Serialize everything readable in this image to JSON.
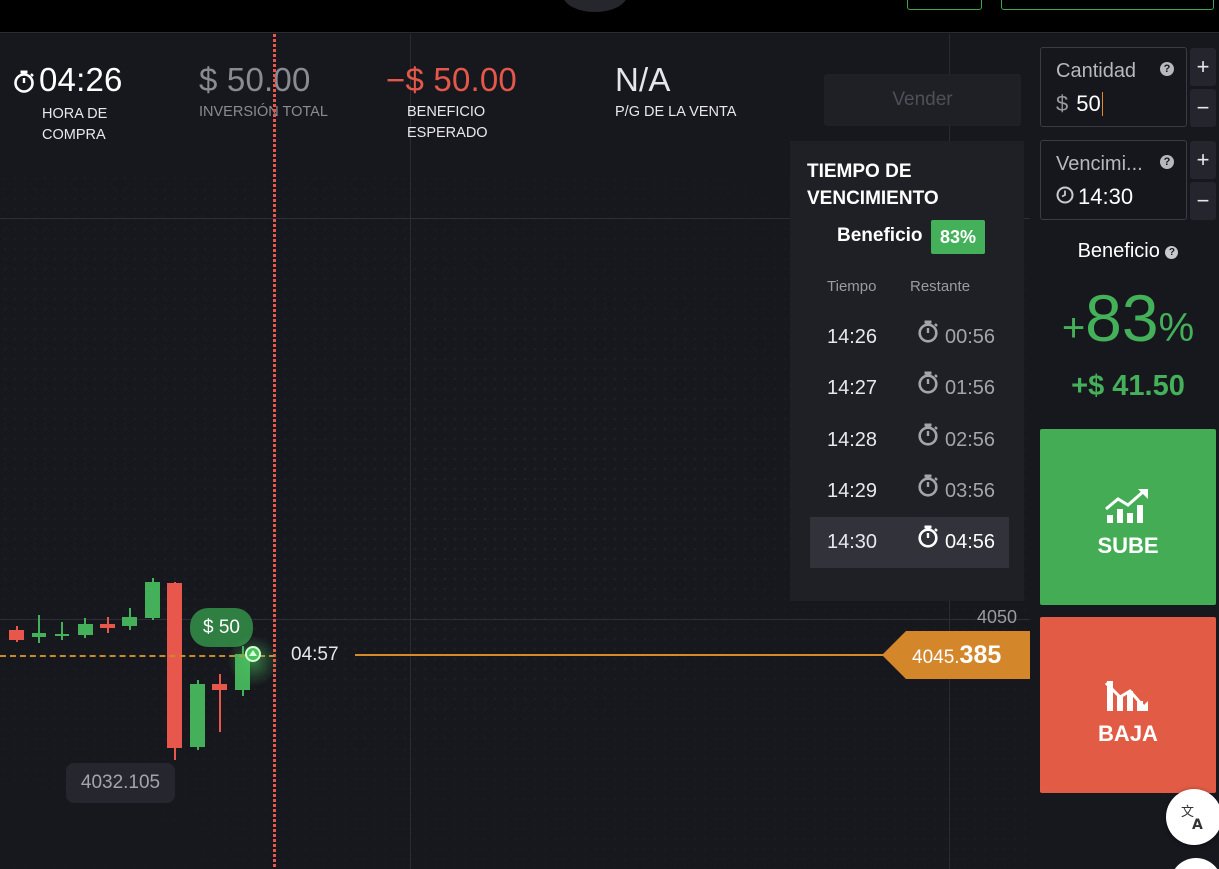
{
  "header": {
    "time_value": "04:26",
    "time_label": "HORA DE COMPRA",
    "investment_value": "$ 50.00",
    "investment_label": "INVERSIÓN TOTAL",
    "expected_value": "−$ 50.00",
    "expected_label": "BENEFICIO ESPERADO",
    "pl_value": "N/A",
    "pl_label": "P/G DE LA VENTA"
  },
  "sell_label": "Vender",
  "chart": {
    "trade_pill": "$ 50",
    "cursor_time": "04:57",
    "price_tick": "4050",
    "current_price_prefix": "4045.",
    "current_price_bold": "385",
    "low_price": "4032.105"
  },
  "expiration_popup": {
    "title": "TIEMPO DE VENCIMIENTO",
    "profit_label": "Beneficio",
    "profit_badge": "83%",
    "col_time": "Tiempo",
    "col_remaining": "Restante",
    "rows": [
      {
        "time": "14:26",
        "remaining": "00:56"
      },
      {
        "time": "14:27",
        "remaining": "01:56"
      },
      {
        "time": "14:28",
        "remaining": "02:56"
      },
      {
        "time": "14:29",
        "remaining": "03:56"
      },
      {
        "time": "14:30",
        "remaining": "04:56"
      }
    ],
    "selected_row": 4
  },
  "panel": {
    "amount_label": "Cantidad",
    "amount_currency": "$",
    "amount_value": "50",
    "expiry_label": "Vencimi...",
    "expiry_value": "14:30",
    "plus": "+",
    "minus": "−",
    "help": "?",
    "profit_label": "Beneficio",
    "profit_pct_prefix": "+",
    "profit_pct": "83",
    "profit_pct_suffix": "%",
    "profit_amount": "+$ 41.50",
    "up_label": "SUBE",
    "down_label": "BAJA"
  },
  "colors": {
    "green": "#45b05a",
    "red": "#e25c45",
    "orange": "#d9892a",
    "background": "#16171d"
  },
  "icons": [
    "stopwatch-icon",
    "clock-icon",
    "help-icon",
    "trend-up-icon",
    "trend-down-icon",
    "translate-icon"
  ]
}
